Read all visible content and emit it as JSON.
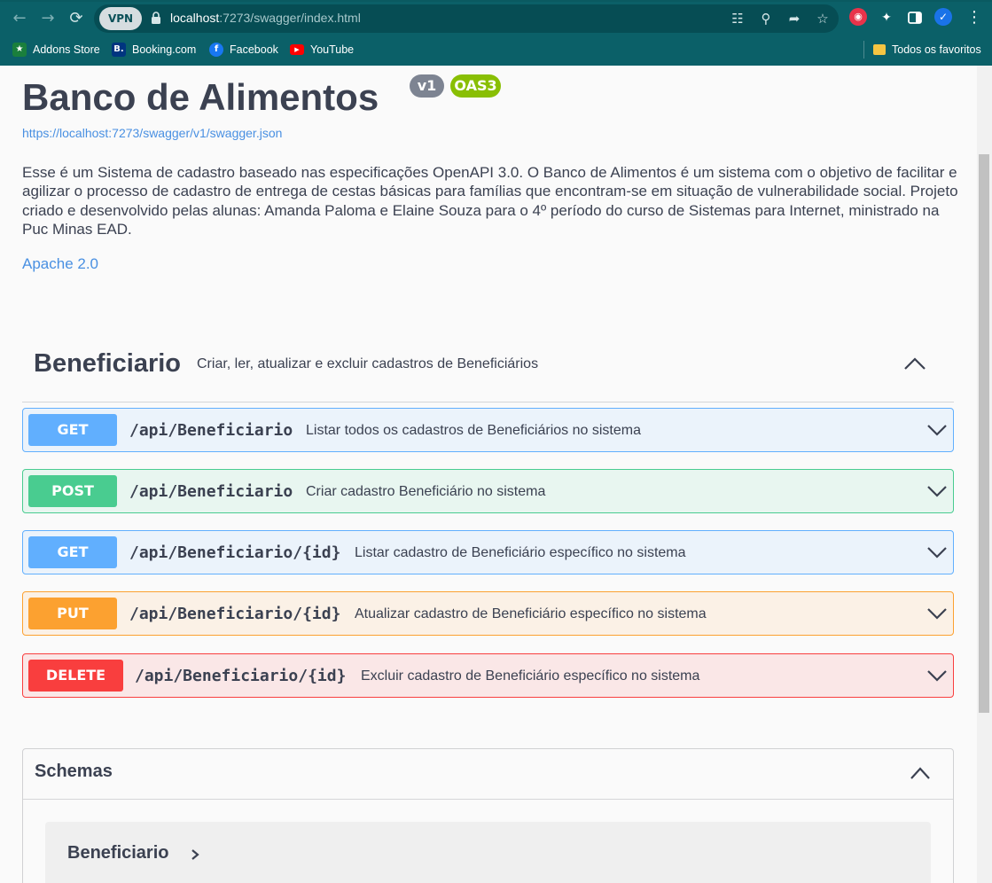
{
  "browser": {
    "url_host": "localhost",
    "url_rest": ":7273/swagger/index.html",
    "vpn_label": "VPN",
    "bookmarks": [
      {
        "label": "Addons Store",
        "icon": "addons-store-icon",
        "color": "#1a7f3c"
      },
      {
        "label": "Booking.com",
        "icon": "booking-icon",
        "color": "#003580"
      },
      {
        "label": "Facebook",
        "icon": "facebook-icon",
        "color": "#1877f2"
      },
      {
        "label": "YouTube",
        "icon": "youtube-icon",
        "color": "#ff0000"
      }
    ],
    "all_bookmarks_label": "Todos os favoritos"
  },
  "header": {
    "title": "Banco de Alimentos",
    "version_badge": "v1",
    "spec_badge": "OAS3",
    "json_link": "https://localhost:7273/swagger/v1/swagger.json",
    "description": "Esse é um Sistema de cadastro baseado nas especificações OpenAPI 3.0. O Banco de Alimentos é um sistema com o objetivo de facilitar e agilizar o processo de cadastro de entrega de cestas básicas para famílias que encontram-se em situação de vulnerabilidade social. Projeto criado e desenvolvido pelas alunas: Amanda Paloma e Elaine Souza para o 4º período do curso de Sistemas para Internet, ministrado na Puc Minas EAD.",
    "license": "Apache 2.0"
  },
  "tag": {
    "name": "Beneficiario",
    "description": "Criar, ler, atualizar e excluir cadastros de Beneficiários"
  },
  "operations": [
    {
      "method": "GET",
      "path": "/api/Beneficiario",
      "summary": "Listar todos os cadastros de Beneficiários no sistema"
    },
    {
      "method": "POST",
      "path": "/api/Beneficiario",
      "summary": "Criar cadastro Beneficiário no sistema"
    },
    {
      "method": "GET",
      "path": "/api/Beneficiario/{id}",
      "summary": "Listar cadastro de Beneficiário específico no sistema"
    },
    {
      "method": "PUT",
      "path": "/api/Beneficiario/{id}",
      "summary": "Atualizar cadastro de Beneficiário específico no sistema"
    },
    {
      "method": "DELETE",
      "path": "/api/Beneficiario/{id}",
      "summary": "Excluir cadastro de Beneficiário específico no sistema"
    }
  ],
  "schemas": {
    "title": "Schemas",
    "models": [
      {
        "name": "Beneficiario"
      }
    ]
  },
  "colors": {
    "get": "#61affe",
    "post": "#49cc90",
    "put": "#fca130",
    "delete": "#f93e3e",
    "text": "#3b4151",
    "link": "#4990e2"
  }
}
